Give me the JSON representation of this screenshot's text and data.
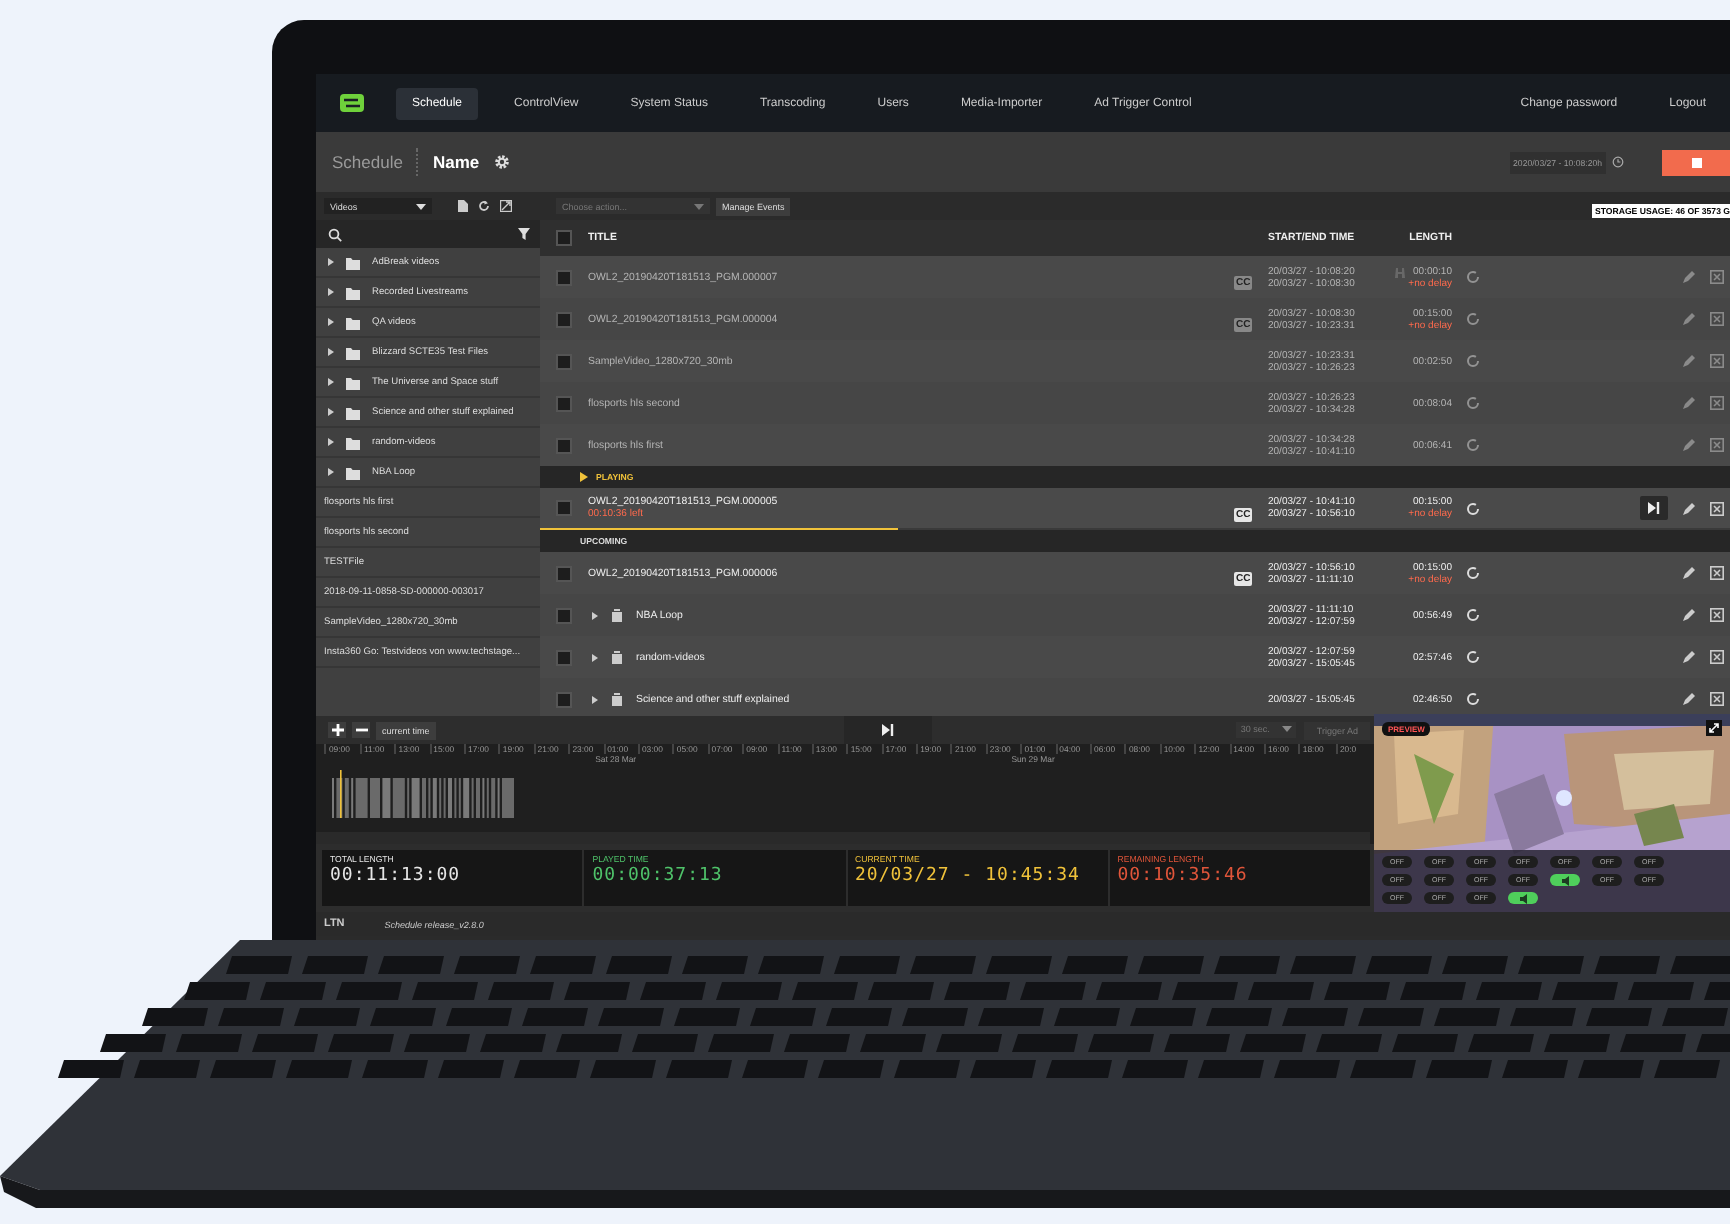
{
  "nav": {
    "tabs": [
      {
        "label": "Schedule",
        "selected": true
      },
      {
        "label": "ControlView",
        "selected": false
      },
      {
        "label": "System Status",
        "selected": false
      },
      {
        "label": "Transcoding",
        "selected": false
      },
      {
        "label": "Users",
        "selected": false
      },
      {
        "label": "Media-Importer",
        "selected": false
      },
      {
        "label": "Ad Trigger Control",
        "selected": false
      }
    ],
    "links": [
      "Change password",
      "Logout"
    ]
  },
  "header": {
    "section": "Schedule",
    "title": "Name",
    "datetime": "2020/03/27 - 10:08:20h"
  },
  "sidebar": {
    "filter": "Videos",
    "items": [
      {
        "kind": "folder",
        "label": "AdBreak videos"
      },
      {
        "kind": "folder",
        "label": "Recorded Livestreams"
      },
      {
        "kind": "folder",
        "label": "QA videos"
      },
      {
        "kind": "folder",
        "label": "Blizzard SCTE35 Test Files"
      },
      {
        "kind": "folder",
        "label": "The Universe and Space stuff"
      },
      {
        "kind": "folder",
        "label": "Science and other stuff explained"
      },
      {
        "kind": "folder",
        "label": "random-videos"
      },
      {
        "kind": "folder",
        "label": "NBA Loop"
      },
      {
        "kind": "file",
        "label": "flosports hls first"
      },
      {
        "kind": "file",
        "label": "flosports hls second"
      },
      {
        "kind": "file",
        "label": "TESTFile"
      },
      {
        "kind": "file",
        "label": "2018-09-11-0858-SD-000000-003017"
      },
      {
        "kind": "file",
        "label": "SampleVideo_1280x720_30mb"
      },
      {
        "kind": "file",
        "label": "Insta360 Go: Testvideos von www.techstage..."
      }
    ]
  },
  "actions": {
    "placeholder": "Choose action...",
    "button": "Manage Events"
  },
  "storage": "STORAGE USAGE: 46 OF 3573 G",
  "table": {
    "columns": [
      "TITLE",
      "START/END TIME",
      "LENGTH"
    ],
    "all_checked": false,
    "rows": [
      {
        "kind": "item",
        "title": "OWL2_20190420T181513_PGM.000007",
        "cc": "CC",
        "start": "20/03/27 - 10:08:20",
        "end": "20/03/27 - 10:08:30",
        "length": "00:00:10",
        "delay": "+no delay",
        "dimmed": true,
        "marker": true,
        "checked": false
      },
      {
        "kind": "item",
        "title": "OWL2_20190420T181513_PGM.000004",
        "cc": "CC",
        "start": "20/03/27 - 10:08:30",
        "end": "20/03/27 - 10:23:31",
        "length": "00:15:00",
        "delay": "+no delay",
        "dimmed": true,
        "checked": false
      },
      {
        "kind": "item",
        "title": "SampleVideo_1280x720_30mb",
        "start": "20/03/27 - 10:23:31",
        "end": "20/03/27 - 10:26:23",
        "length": "00:02:50",
        "dimmed": true,
        "checked": false
      },
      {
        "kind": "item",
        "title": "flosports hls second",
        "start": "20/03/27 - 10:26:23",
        "end": "20/03/27 - 10:34:28",
        "length": "00:08:04",
        "dimmed": true,
        "checked": false
      },
      {
        "kind": "item",
        "title": "flosports hls first",
        "start": "20/03/27 - 10:34:28",
        "end": "20/03/27 - 10:41:10",
        "length": "00:06:41",
        "dimmed": true,
        "checked": false
      },
      {
        "kind": "section",
        "label": "PLAYING",
        "active": true
      },
      {
        "kind": "item",
        "title": "OWL2_20190420T181513_PGM.000005",
        "remaining": "00:10:36 left",
        "cc": "CC",
        "start": "20/03/27 - 10:41:10",
        "end": "20/03/27 - 10:56:10",
        "length": "00:15:00",
        "delay": "+no delay",
        "dimmed": false,
        "playing": true,
        "level": 0.3,
        "checked": false
      },
      {
        "kind": "section",
        "label": "UPCOMING",
        "active": false
      },
      {
        "kind": "item",
        "title": "OWL2_20190420T181513_PGM.000006",
        "cc": "CC",
        "start": "20/03/27 - 10:56:10",
        "end": "20/03/27 - 11:11:10",
        "length": "00:15:00",
        "delay": "+no delay",
        "dimmed": false,
        "checked": false
      },
      {
        "kind": "group",
        "title": "NBA Loop",
        "start": "20/03/27 - 11:11:10",
        "end": "20/03/27 - 12:07:59",
        "length": "00:56:49",
        "dimmed": false,
        "checked": false
      },
      {
        "kind": "group",
        "title": "random-videos",
        "start": "20/03/27 - 12:07:59",
        "end": "20/03/27 - 15:05:45",
        "length": "02:57:46",
        "dimmed": false,
        "checked": false
      },
      {
        "kind": "group",
        "title": "Science and other stuff explained",
        "start": "20/03/27 - 15:05:45",
        "length": "02:46:50",
        "dimmed": false,
        "checked": false
      }
    ]
  },
  "timeline": {
    "zoom_button": "current time",
    "interval": "30 sec.",
    "trigger": "Trigger Ad",
    "ticks": [
      {
        "label": "09:00"
      },
      {
        "label": "11:00"
      },
      {
        "label": "13:00"
      },
      {
        "label": "15:00"
      },
      {
        "label": "17:00"
      },
      {
        "label": "19:00"
      },
      {
        "label": "21:00"
      },
      {
        "label": "23:00"
      },
      {
        "label": "01:00",
        "date": "Sat 28 Mar"
      },
      {
        "label": "03:00"
      },
      {
        "label": "05:00"
      },
      {
        "label": "07:00"
      },
      {
        "label": "09:00"
      },
      {
        "label": "11:00"
      },
      {
        "label": "13:00"
      },
      {
        "label": "15:00"
      },
      {
        "label": "17:00"
      },
      {
        "label": "19:00"
      },
      {
        "label": "21:00"
      },
      {
        "label": "23:00"
      },
      {
        "label": "01:00",
        "date": "Sun 29 Mar"
      },
      {
        "label": "04:00"
      },
      {
        "label": "06:00"
      },
      {
        "label": "08:00"
      },
      {
        "label": "10:00"
      },
      {
        "label": "12:00"
      },
      {
        "label": "14:00"
      },
      {
        "label": "16:00"
      },
      {
        "label": "18:00"
      },
      {
        "label": "20:0"
      }
    ]
  },
  "stats": [
    {
      "label": "TOTAL LENGTH",
      "value": "00:11:13:00",
      "color": "#e6e6e6"
    },
    {
      "label": "PLAYED TIME",
      "value": "00:00:37:13",
      "color": "#4fc36a"
    },
    {
      "label": "CURRENT TIME",
      "value": "20/03/27 - 10:45:34",
      "color": "#f0c23a"
    },
    {
      "label": "REMAINING LENGTH",
      "value": "00:10:35:46",
      "color": "#e0553a"
    }
  ],
  "preview": {
    "badge": "PREVIEW",
    "toggles": [
      {
        "label": "OFF",
        "on": false
      },
      {
        "label": "OFF",
        "on": false
      },
      {
        "label": "OFF",
        "on": false
      },
      {
        "label": "OFF",
        "on": false
      },
      {
        "label": "OFF",
        "on": false
      },
      {
        "label": "OFF",
        "on": false
      },
      {
        "label": "OFF",
        "on": false
      },
      {
        "label": "OFF",
        "on": false
      },
      {
        "label": "OFF",
        "on": false
      },
      {
        "label": "OFF",
        "on": false
      },
      {
        "label": "OFF",
        "on": false
      },
      {
        "on": true
      },
      {
        "label": "OFF",
        "on": false
      },
      {
        "label": "OFF",
        "on": false
      },
      {
        "label": "OFF",
        "on": false
      },
      {
        "label": "OFF",
        "on": false
      },
      {
        "label": "OFF",
        "on": false
      },
      {
        "on": true
      }
    ]
  },
  "footer": {
    "logo": "LTN",
    "version": "Schedule release_v2.8.0"
  }
}
